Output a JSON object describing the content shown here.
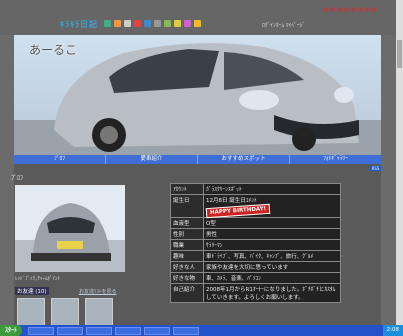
{
  "topbar": {
    "logo": "ｷﾗｷﾗ日記",
    "links": "ﾛｸﾞｲﾝﾎｰﾑ  ﾏｲﾍﾟｰｼﾞ"
  },
  "site": {
    "title": "あーるこ"
  },
  "nav": [
    "ﾌﾟﾛﾌ",
    "愛車紹介",
    "おすすめスポット",
    "ﾌｫﾄｷﾞｬﾗﾘｰ"
  ],
  "feed": "RSS",
  "section": "ﾌﾟﾛﾌ",
  "photo_caption": "ﾚｯﾄﾞﾌﾟｯｸ｡ﾁｬｰﾑﾎﾟｲﾝﾄ",
  "friends": {
    "title": "お友達 (10)",
    "link": "お友達ﾘｽﾄを見る"
  },
  "profile": [
    {
      "k": "ｱｶｳﾝﾄ",
      "v": "ｶﾞﾗｽｸﾘｰﾝｽﾎﾟｯﾄ"
    },
    {
      "k": "誕生日",
      "v": "12月8日 誕生日ｺﾒﾝﾄ",
      "badge": "HAPPY BIRTHDAY!"
    },
    {
      "k": "血液型",
      "v": "O型"
    },
    {
      "k": "性別",
      "v": "男性"
    },
    {
      "k": "職業",
      "v": "ｻﾗﾘｰﾏﾝ"
    },
    {
      "k": "趣味",
      "v": "車ﾄﾞﾗｲﾌﾞ、写真、ﾊﾞｲｸ、ｷｬﾝﾌﾟ、旅行、ｸﾞﾙﾒ"
    },
    {
      "k": "好きな人",
      "v": "家族や友達を大切に思っています"
    },
    {
      "k": "好きな物",
      "v": "車、ｶﾒﾗ、音楽、ﾊﾟｿｺﾝ"
    },
    {
      "k": "自己紹介",
      "v": "2008年1月からR1ｵｰﾅｰになりました。ﾎﾞﾁﾎﾞﾁとｶｽﾀﾑしていきます。よろしくお願いします。"
    }
  ],
  "taskbar": {
    "start": "ｽﾀｰﾄ",
    "time": "2:08"
  }
}
